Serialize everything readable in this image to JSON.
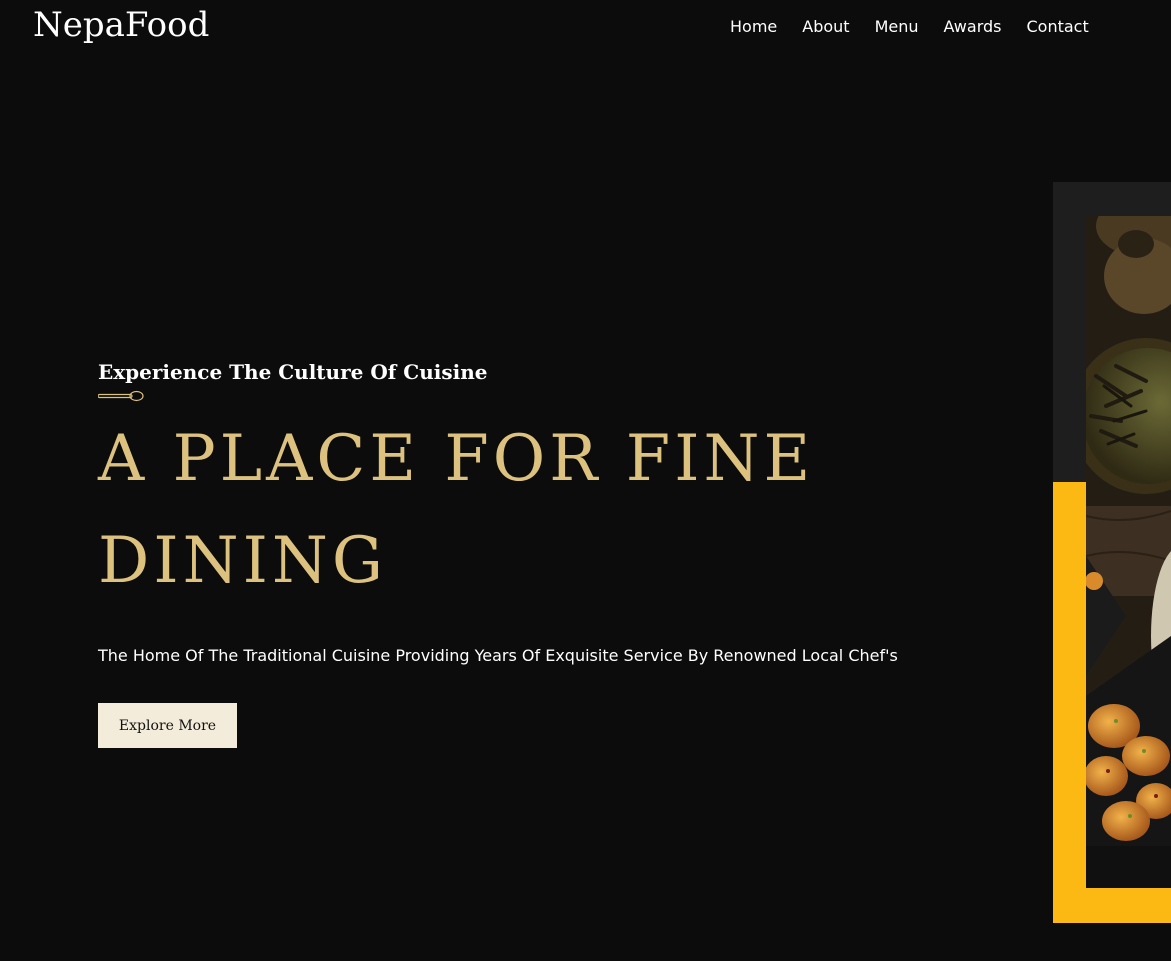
{
  "header": {
    "logo": "NepaFood",
    "nav": [
      {
        "label": "Home"
      },
      {
        "label": "About"
      },
      {
        "label": "Menu"
      },
      {
        "label": "Awards"
      },
      {
        "label": "Contact"
      }
    ]
  },
  "hero": {
    "subtitle": "Experience The Culture Of Cuisine",
    "divider_icon": "spoon-icon",
    "headline": "A PLACE FOR FINE DINING",
    "description": "The Home Of The Traditional Cuisine Providing Years Of Exquisite Service By Renowned Local Chef's",
    "button_label": "Explore More",
    "image_subject": "food-platter-image"
  },
  "colors": {
    "background": "#0c0c0c",
    "accent_gold": "#dcc27e",
    "frame_dark": "#1e1e1e",
    "frame_yellow": "#fdb913",
    "button_bg": "#f4ecda"
  }
}
